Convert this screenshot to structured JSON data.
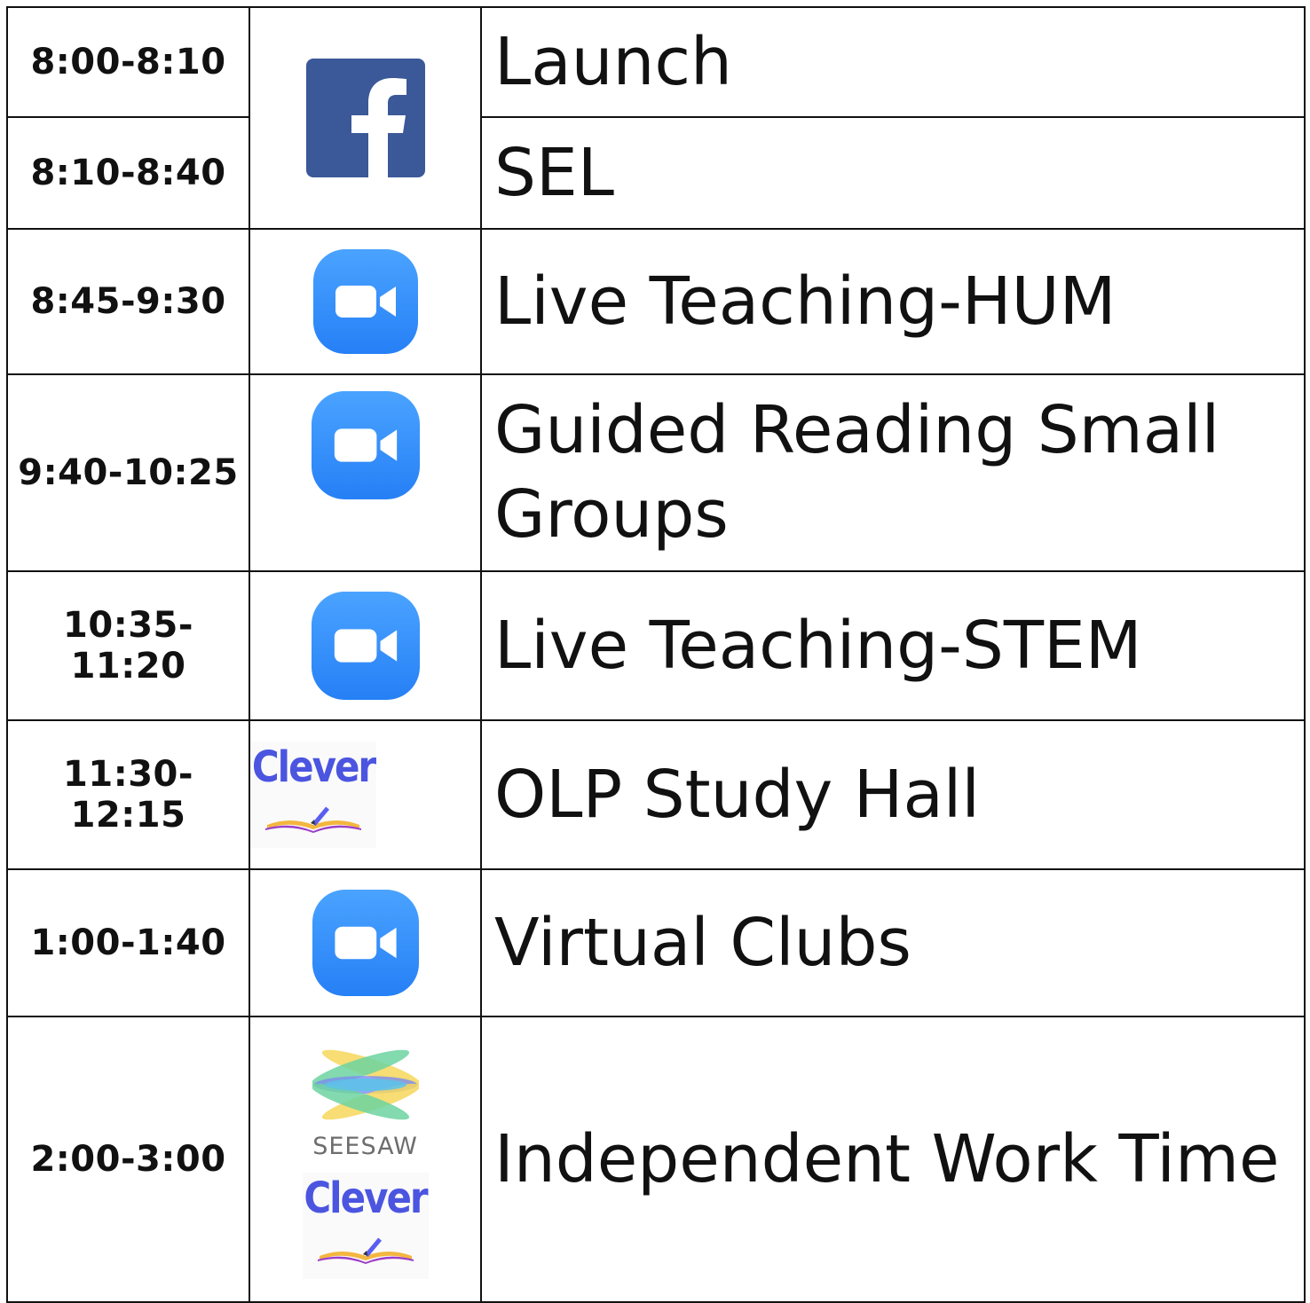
{
  "schedule": [
    {
      "time": "8:00-8:10",
      "activity": "Launch",
      "icon": "facebook-icon"
    },
    {
      "time": "8:10-8:40",
      "activity": "SEL",
      "icon": "facebook-icon"
    },
    {
      "time": "8:45-9:30",
      "activity": "Live Teaching-HUM",
      "icon": "zoom-icon"
    },
    {
      "time": "9:40-10:25",
      "activity": "Guided Reading Small Groups",
      "icon": "zoom-icon"
    },
    {
      "time": "10:35-11:20",
      "activity": "Live Teaching-STEM",
      "icon": "zoom-icon"
    },
    {
      "time": "11:30-12:15",
      "activity": "OLP Study Hall",
      "icon": "clever-icon"
    },
    {
      "time": "1:00-1:40",
      "activity": "Virtual Clubs",
      "icon": "zoom-icon"
    },
    {
      "time": "2:00-3:00",
      "activity": "Independent Work Time",
      "icon": [
        "seesaw-icon",
        "clever-icon"
      ]
    }
  ],
  "logos": {
    "clever_text": "Clever",
    "seesaw_text": "SEESAW"
  },
  "colors": {
    "facebook_blue": "#3b5998",
    "zoom_blue": "#2d8cff",
    "clever_purple": "#4b55e0",
    "grid": "#111111"
  }
}
